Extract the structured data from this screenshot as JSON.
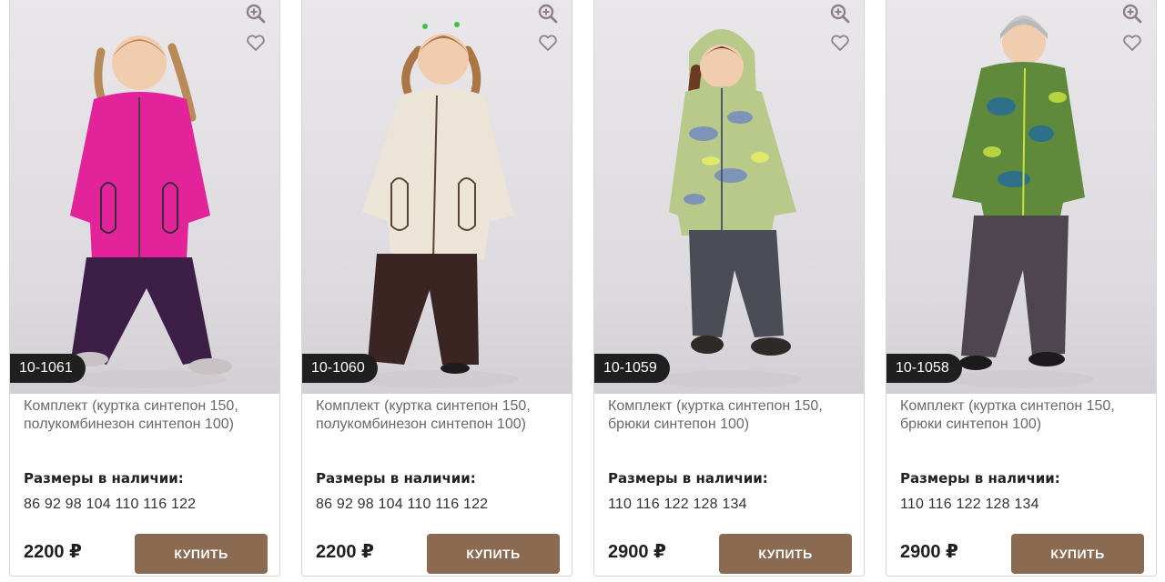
{
  "accent_color": "#8b6a52",
  "products": [
    {
      "sku": "10-1061",
      "title": "Комплект (куртка синтепон 150, полукомбинезон синтепон 100)",
      "sizes_label": "Размеры в наличии:",
      "sizes": "86 92 98 104 110 116 122",
      "price": "2200 ₽",
      "buy_label": "КУПИТЬ",
      "jacket_color": "#e3239a",
      "pants_color": "#3d1e47",
      "hair_color": "#b88a58"
    },
    {
      "sku": "10-1060",
      "title": "Комплект (куртка синтепон 150, полукомбинезон синтепон 100)",
      "sizes_label": "Размеры в наличии:",
      "sizes": "86 92 98 104 110 116 122",
      "price": "2200 ₽",
      "buy_label": "КУПИТЬ",
      "jacket_color": "#ece4d6",
      "pants_color": "#3a2523",
      "hair_color": "#a97644"
    },
    {
      "sku": "10-1059",
      "title": "Комплект (куртка синтепон 150, брюки синтепон 100)",
      "sizes_label": "Размеры в наличии:",
      "sizes": "110 116 122 128 134",
      "price": "2900 ₽",
      "buy_label": "КУПИТЬ",
      "jacket_color": "#b8c98a",
      "pants_color": "#4a4d56",
      "hair_color": "#6b3a22"
    },
    {
      "sku": "10-1058",
      "title": "Комплект (куртка синтепон 150, брюки синтепон 100)",
      "sizes_label": "Размеры в наличии:",
      "sizes": "110 116 122 128 134",
      "price": "2900 ₽",
      "buy_label": "КУПИТЬ",
      "jacket_color": "#5f8a3c",
      "pants_color": "#4e4550",
      "hair_color": "#c8c8c8"
    }
  ]
}
